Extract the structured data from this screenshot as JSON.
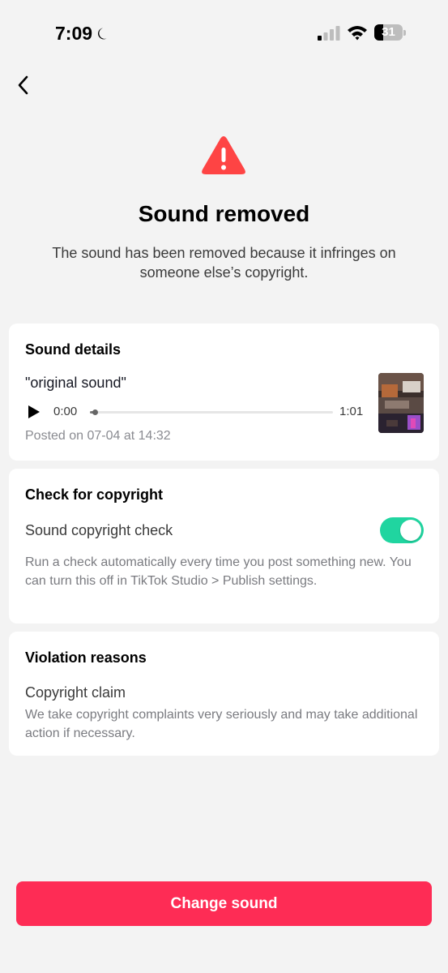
{
  "status_bar": {
    "time": "7:09",
    "battery_level": "31",
    "battery_fraction": 0.31,
    "icons": [
      "moon-icon",
      "signal-icon",
      "wifi-icon",
      "battery-icon"
    ]
  },
  "header": {
    "back_icon": "chevron-left-icon"
  },
  "alert": {
    "icon": "warning-icon",
    "icon_color": "#fe4444",
    "title": "Sound removed",
    "message": "The sound has been removed because it infringes on someone else’s copyright."
  },
  "sound_details": {
    "heading": "Sound details",
    "name": "\"original sound\"",
    "current_time": "0:00",
    "duration": "1:01",
    "progress": 0.02,
    "posted": "Posted on 07-04 at 14:32"
  },
  "copyright_check": {
    "heading": "Check for copyright",
    "label": "Sound copyright check",
    "enabled": true,
    "toggle_color": "#20d5a0",
    "description": "Run a check automatically every time you post something new. You can turn this off in TikTok Studio > Publish settings."
  },
  "violation": {
    "heading": "Violation reasons",
    "reason": "Copyright claim",
    "description": "We take copyright complaints very seriously and may take additional action if necessary."
  },
  "actions": {
    "change_sound_label": "Change sound",
    "button_color": "#fe2c55"
  }
}
